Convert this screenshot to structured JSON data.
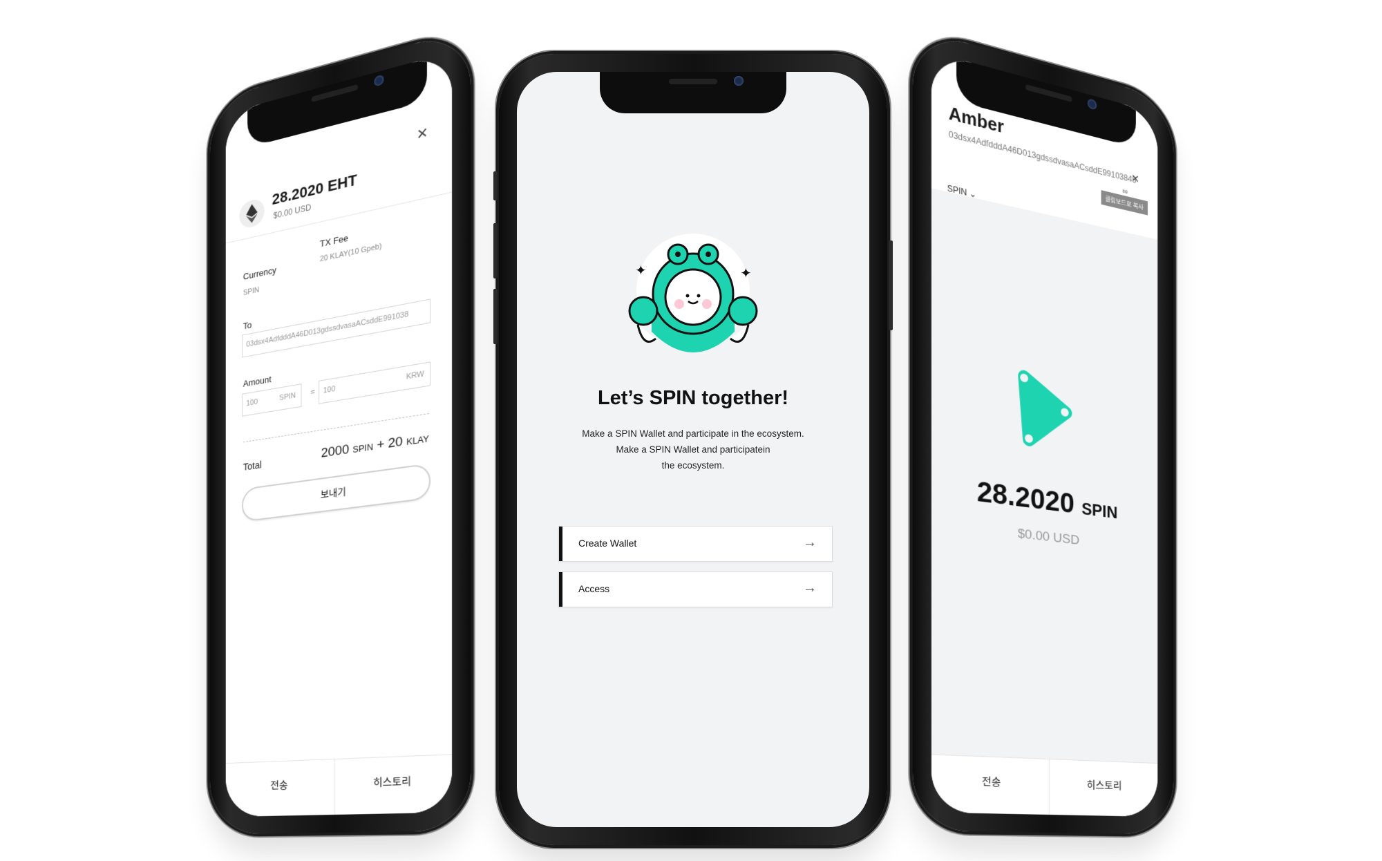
{
  "left_screen": {
    "amount": "28.2020 EHT",
    "usd": "$0.00 USD",
    "close_glyph": "×",
    "currency_label": "Currency",
    "currency_value": "SPIN",
    "txfee_label": "TX Fee",
    "txfee_value": "20 KLAY(10 Gpeb)",
    "to_label": "To",
    "to_value": "03dsx4AdfdddA46D013gdssdvasaACsddE991038",
    "amount_label": "Amount",
    "amount_spin_value": "100",
    "amount_spin_unit": "SPIN",
    "equals": "=",
    "amount_krw_value": "100",
    "amount_krw_unit": "KRW",
    "total_label": "Total",
    "total_spin_num": "2000",
    "total_spin_unit": "SPIN",
    "total_plus": "+",
    "total_klay_num": "20",
    "total_klay_unit": "KLAY",
    "send_button": "보내기",
    "tab_send": "전송",
    "tab_history": "히스토리",
    "icons": [
      "ethereum-icon",
      "close-icon"
    ]
  },
  "center_screen": {
    "title": "Let’s SPIN together!",
    "desc_line1": "Make a SPIN Wallet and participate in the ecosystem.",
    "desc_line2": "Make a SPIN Wallet and participatein",
    "desc_line3": "the ecosystem.",
    "create_wallet": "Create Wallet",
    "access": "Access",
    "arrow_glyph": "→",
    "accent_color": "#1dd3b0"
  },
  "right_screen": {
    "name": "Amber",
    "address": "03dsx4AdfdddA46D013gdssdvasaACsddE99103845",
    "link_glyph": "∞",
    "close_glyph": "×",
    "tooltip": "클립보드로 복사",
    "selected_token": "SPIN",
    "amount_num": "28.2020",
    "amount_unit": "SPIN",
    "usd": "$0.00 USD",
    "tab_send": "전송",
    "tab_history": "히스토리",
    "logo_color": "#1dd3b0"
  }
}
